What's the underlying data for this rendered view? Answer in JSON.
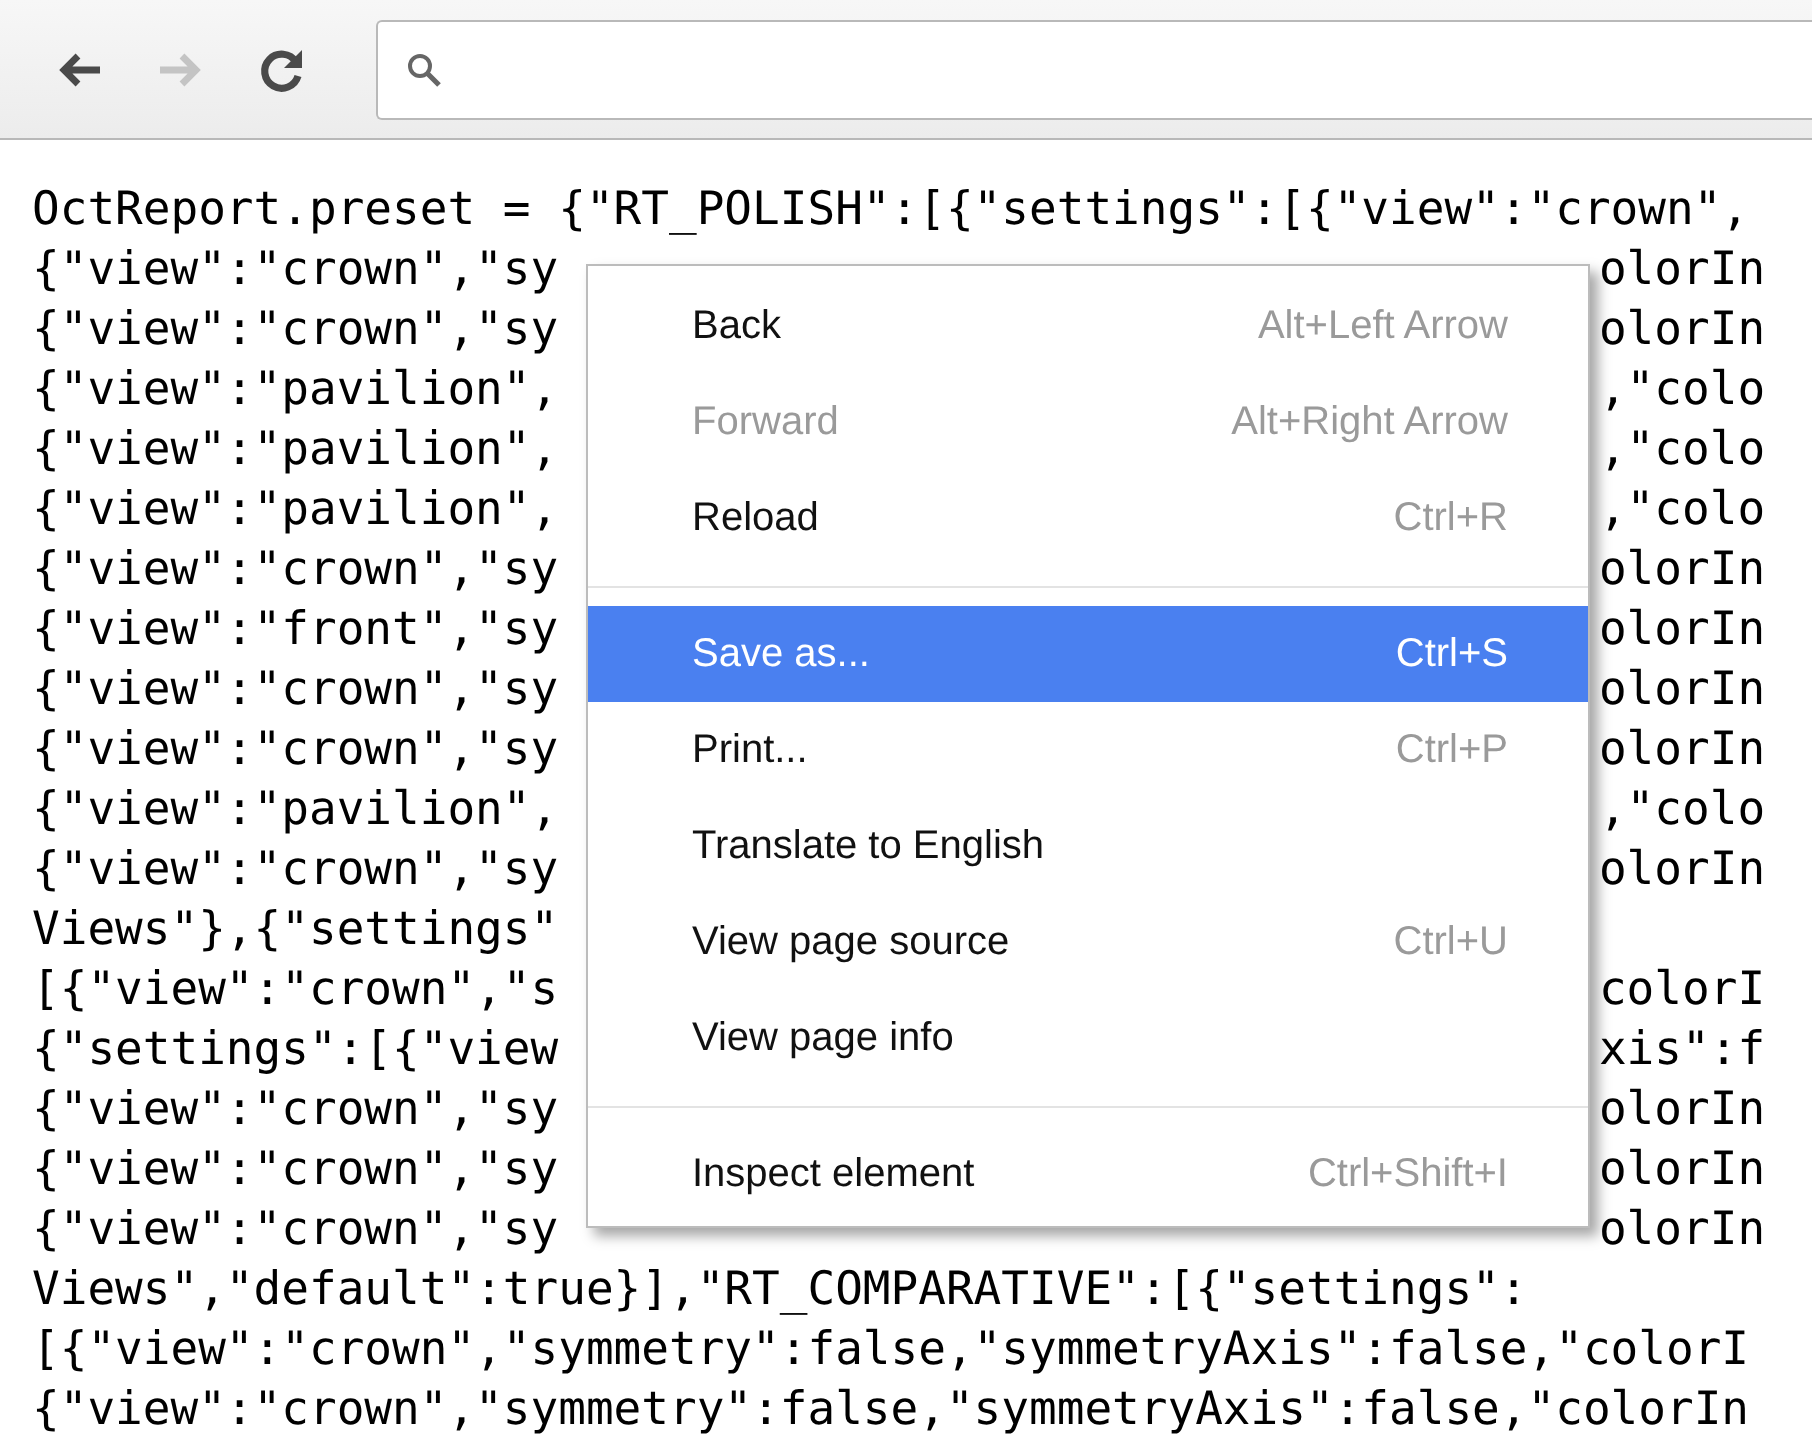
{
  "toolbar": {
    "nav_buttons": [
      {
        "kind": "back",
        "disabled": false
      },
      {
        "kind": "forward",
        "disabled": true
      },
      {
        "kind": "reload",
        "disabled": false
      }
    ]
  },
  "code_lines": [
    {
      "left": "OctReport.preset = {\"RT_POLISH\":[{\"settings\":[{\"view\":\"crown\","
    },
    {
      "left": "{\"view\":\"crown\",\"sy",
      "right": "olorIn"
    },
    {
      "left": "{\"view\":\"crown\",\"sy",
      "right": "olorIn"
    },
    {
      "left": "{\"view\":\"pavilion\",",
      "right": ",\"colo"
    },
    {
      "left": "{\"view\":\"pavilion\",",
      "right": ",\"colo"
    },
    {
      "left": "{\"view\":\"pavilion\",",
      "right": ",\"colo"
    },
    {
      "left": "{\"view\":\"crown\",\"sy",
      "right": "olorIn"
    },
    {
      "left": "{\"view\":\"front\",\"sy",
      "right": "olorIn"
    },
    {
      "left": "{\"view\":\"crown\",\"sy",
      "right": "olorIn"
    },
    {
      "left": "{\"view\":\"crown\",\"sy",
      "right": "olorIn"
    },
    {
      "left": "{\"view\":\"pavilion\",",
      "right": ",\"colo"
    },
    {
      "left": "{\"view\":\"crown\",\"sy",
      "right": "olorIn"
    },
    {
      "left": "Views\"},{\"settings\""
    },
    {
      "left": "[{\"view\":\"crown\",\"s",
      "right": "colorI"
    },
    {
      "left": "{\"settings\":[{\"view",
      "right": "xis\":f"
    },
    {
      "left": "{\"view\":\"crown\",\"sy",
      "right": "olorIn"
    },
    {
      "left": "{\"view\":\"crown\",\"sy",
      "right": "olorIn"
    },
    {
      "left": "{\"view\":\"crown\",\"sy",
      "right": "olorIn"
    },
    {
      "left": "Views\",\"default\":true}],\"RT_COMPARATIVE\":[{\"settings\":"
    },
    {
      "left": "[{\"view\":\"crown\",\"symmetry\":false,\"symmetryAxis\":false,\"colorI"
    },
    {
      "left": "{\"view\":\"crown\",\"symmetry\":false,\"symmetryAxis\":false,\"colorIn"
    }
  ],
  "context_menu": {
    "items": [
      {
        "kind": "item",
        "label": "Back",
        "shortcut": "Alt+Left Arrow",
        "disabled": false,
        "selected": false
      },
      {
        "kind": "item",
        "label": "Forward",
        "shortcut": "Alt+Right Arrow",
        "disabled": true,
        "selected": false
      },
      {
        "kind": "item",
        "label": "Reload",
        "shortcut": "Ctrl+R",
        "disabled": false,
        "selected": false
      },
      {
        "kind": "separator"
      },
      {
        "kind": "item",
        "label": "Save as...",
        "shortcut": "Ctrl+S",
        "disabled": false,
        "selected": true
      },
      {
        "kind": "item",
        "label": "Print...",
        "shortcut": "Ctrl+P",
        "disabled": false,
        "selected": false
      },
      {
        "kind": "item",
        "label": "Translate to English",
        "disabled": false,
        "selected": false
      },
      {
        "kind": "item",
        "label": "View page source",
        "shortcut": "Ctrl+U",
        "disabled": false,
        "selected": false
      },
      {
        "kind": "item",
        "label": "View page info",
        "disabled": false,
        "selected": false
      },
      {
        "kind": "separator"
      },
      {
        "kind": "item",
        "label": "Inspect element",
        "shortcut": "Ctrl+Shift+I",
        "disabled": false,
        "selected": false
      }
    ]
  }
}
